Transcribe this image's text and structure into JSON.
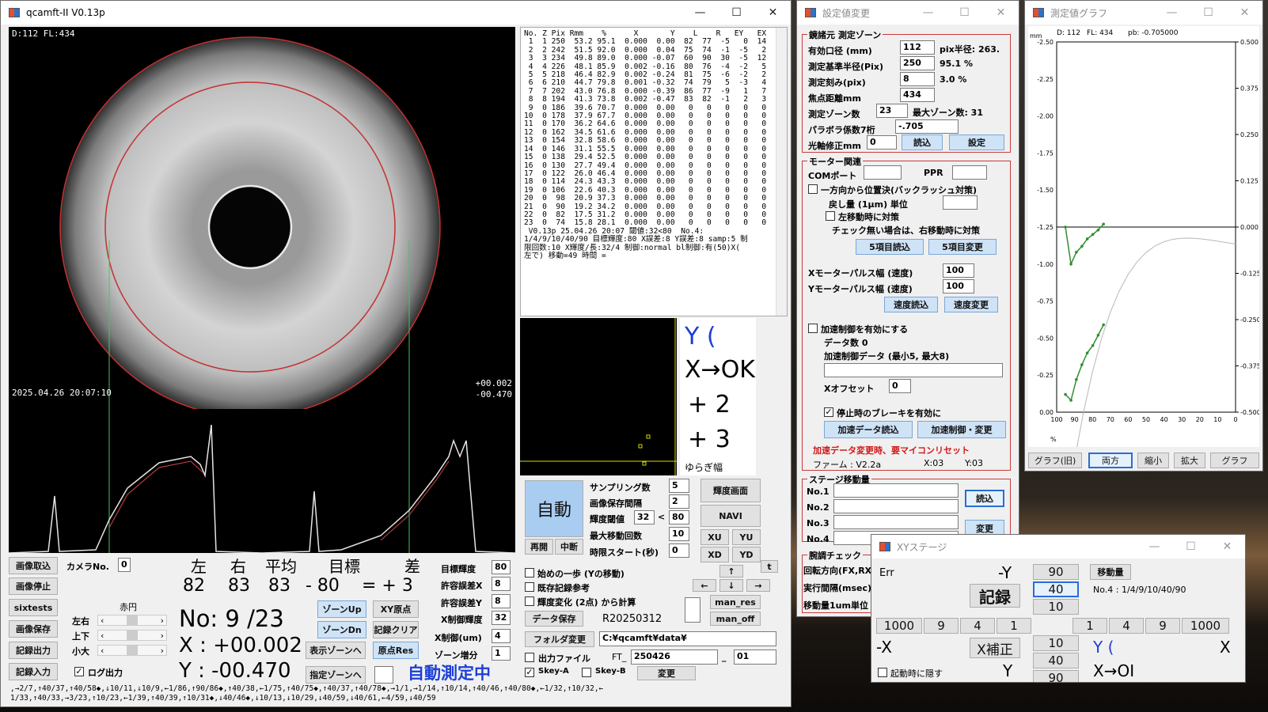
{
  "main": {
    "title": "qcamft-II  V0.13p",
    "overlay_top": "D:112 FL:434",
    "overlay_date": "2025.04.26 20:07:10",
    "overlay_x": "+00.002",
    "overlay_y": "-00.470",
    "table_header": "No. Z Pix Rmm    %      X       Y    L    R   EY   EX   N",
    "table_rows": [
      " 1  1 250  53.2 95.1  0.000  0.00  82  77  -5   0  14",
      " 2  2 242  51.5 92.0  0.000  0.04  75  74  -1  -5   2",
      " 3  3 234  49.8 89.0  0.000 -0.07  60  90  30  -5  12",
      " 4  4 226  48.1 85.9  0.002 -0.16  80  76  -4  -2   5",
      " 5  5 218  46.4 82.9  0.002 -0.24  81  75  -6  -2   2",
      " 6  6 210  44.7 79.8  0.001 -0.32  74  79   5  -3   4",
      " 7  7 202  43.0 76.8  0.000 -0.39  86  77  -9   1   7",
      " 8  8 194  41.3 73.8  0.002 -0.47  83  82  -1   2   3",
      " 9  0 186  39.6 70.7  0.000  0.00   0   0   0   0   0",
      "10  0 178  37.9 67.7  0.000  0.00   0   0   0   0   0",
      "11  0 170  36.2 64.6  0.000  0.00   0   0   0   0   0",
      "12  0 162  34.5 61.6  0.000  0.00   0   0   0   0   0",
      "13  0 154  32.8 58.6  0.000  0.00   0   0   0   0   0",
      "14  0 146  31.1 55.5  0.000  0.00   0   0   0   0   0",
      "15  0 138  29.4 52.5  0.000  0.00   0   0   0   0   0",
      "16  0 130  27.7 49.4  0.000  0.00   0   0   0   0   0",
      "17  0 122  26.0 46.4  0.000  0.00   0   0   0   0   0",
      "18  0 114  24.3 43.3  0.000  0.00   0   0   0   0   0",
      "19  0 106  22.6 40.3  0.000  0.00   0   0   0   0   0",
      "20  0  98  20.9 37.3  0.000  0.00   0   0   0   0   0",
      "21  0  90  19.2 34.2  0.000  0.00   0   0   0   0   0",
      "22  0  82  17.5 31.2  0.000  0.00   0   0   0   0   0",
      "23  0  74  15.8 28.1  0.000  0.00   0   0   0   0   0"
    ],
    "table_note1": " V0.13p 25.04.26 20:07 閾値:32<80  No.4:",
    "table_note2": "1/4/9/10/40/90 目標輝度:80 X誤差:8 Y誤差:8 samp:5 制",
    "table_note3": "限回数:10 X輝度/長:32/4 制御:normal bl制御:有(50)X(",
    "table_note4": "左で) 移動=49 時間 =",
    "yx_y": "Y (",
    "yx_x": "X→OK",
    "yx_p1": "+    2",
    "yx_p2": "+    3",
    "yuragi": "ゆらぎ幅",
    "btn_capture": "画像取込",
    "btn_stop": "画像停止",
    "btn_sixtests": "sixtests",
    "btn_save_img": "画像保存",
    "btn_rec_out": "記録出力",
    "btn_rec_in": "記録入力",
    "camera_no_label": "カメラNo.",
    "camera_no": "0",
    "akaen": "赤円",
    "lr": "左右",
    "ud": "上下",
    "sm": "小大",
    "log_out": "ログ出力",
    "hdr_left": "左",
    "hdr_right": "右",
    "hdr_avg": "平均",
    "hdr_target": "目標",
    "hdr_diff": "差",
    "val_left": "82",
    "val_right": "83",
    "val_avg": "83",
    "val_target": "- 80",
    "val_diff": "= + 3",
    "no_label": "No: 9 /23",
    "x_label": "X : +00.002",
    "y_label": "Y : -00.470",
    "btn_zoneup": "ゾーンUp",
    "btn_zonedn": "ゾーンDn",
    "btn_dispzone": "表示ゾーンへ",
    "btn_speczone": "指定ゾーンへ",
    "btn_xyorigin": "XY原点",
    "btn_recclear": "記録クリア",
    "btn_originres": "原点Res",
    "auto_status": "自動測定中",
    "target_bright_label": "目標輝度",
    "target_bright": "80",
    "tol_x_label": "許容誤差X",
    "tol_x": "8",
    "tol_y_label": "許容誤差Y",
    "tol_y": "8",
    "x_ctrl_bright_label": "X制御輝度",
    "x_ctrl_bright": "32",
    "x_ctrl_um_label": "X制御(um)",
    "x_ctrl_um": "4",
    "zone_inc_label": "ゾーン増分",
    "zone_inc": "1",
    "btn_auto": "自動",
    "btn_resume": "再開",
    "btn_pause": "中断",
    "sampling_label": "サンプリング数",
    "sampling": "5",
    "save_interval_label": "画像保存間隔",
    "save_interval": "2",
    "thresh_label": "輝度閾値",
    "thresh": "32",
    "thresh_cmp": "<",
    "thresh2": "80",
    "max_move_label": "最大移動回数",
    "max_move": "10",
    "delay_label": "時限スタート(秒)",
    "delay": "0",
    "btn_bright": "輝度画面",
    "btn_navi": "NAVI",
    "btn_xu": "XU",
    "btn_yu": "YU",
    "btn_xd": "XD",
    "btn_yd": "YD",
    "chk_first_step": "始めの一歩 (Yの移動)",
    "chk_existing": "既存記録参考",
    "chk_bright_change": "輝度変化 (2点) から計算",
    "btn_data_save": "データ保存",
    "record_name": "R20250312",
    "btn_up": "↑",
    "btn_left": "←",
    "btn_down": "↓",
    "btn_right": "→",
    "btn_t": "t",
    "btn_man_res": "man_res",
    "btn_man_off": "man_off",
    "btn_folder": "フォルダ変更",
    "folder_path": "C:¥qcamft¥data¥",
    "chk_outfile": "出力ファイル",
    "ft_label": "FT_",
    "ft_value": "250426",
    "ft_sep": "_",
    "ft_suffix": "01",
    "skey_a": "Skey-A",
    "skey_b": "Skey-B",
    "btn_change": "変更",
    "log_line1": ",→2/7,↑40/37,↑40/58◆,↓10/11,↓10/9,←1/86,↑90/86◆,↑40/38,←1/75,↑40/75◆,↑40/37,↑40/78◆,→1/1,→1/14,↑10/14,↑40/46,↑40/80◆,←1/32,↑10/32,←",
    "log_line2": "1/33,↑40/33,→3/23,↑10/23,←1/39,↑40/39,↑10/31◆,↓40/46◆,↓10/13,↓10/29,↓40/59,↓40/61,←4/59,↓40/59"
  },
  "settings": {
    "title": "設定値変更",
    "grp_mirror": "鏡諸元 測定ゾーン",
    "aperture_label": "有効口径 (mm)",
    "aperture": "112",
    "pix_radius_label": "pix半径: 263.",
    "ref_radius_label": "測定基準半径(Pix)",
    "ref_radius": "250",
    "ref_pct": "95.1 %",
    "step_label": "測定刻み(pix)",
    "step": "8",
    "step_pct": "3.0 %",
    "focal_label": "焦点距離mm",
    "focal": "434",
    "zones_label": "測定ゾーン数",
    "zones": "23",
    "max_zones_label": "最大ゾーン数:  31",
    "parabola_label": "パラボラ係数7桁",
    "parabola": "-.705",
    "optaxis_label": "光軸修正mm",
    "optaxis": "0",
    "btn_read": "読込",
    "btn_set": "設定",
    "grp_motor": "モーター関連",
    "com_label": "COMポート",
    "com": "",
    "ppr_label": "PPR",
    "ppr": "",
    "chk_oneway": "一方向から位置決(バックラッシュ対策)",
    "return_label": "戻し量 (1μm) 単位",
    "return_val": "",
    "chk_left": "左移動時に対策",
    "note_right": "チェック無い場合は、右移動時に対策",
    "btn_5read": "5項目読込",
    "btn_5change": "5項目変更",
    "xpulse_label": "Xモーターパルス幅 (速度)",
    "xpulse": "100",
    "ypulse_label": "Yモーターパルス幅 (速度)",
    "ypulse": "100",
    "btn_speed_read": "速度読込",
    "btn_speed_change": "速度変更",
    "chk_accel": "加速制御を有効にする",
    "data_count": "データ数  0",
    "accel_data_label": "加速制御データ (最小5, 最大8)",
    "accel_data": "",
    "xoffset_label": "Xオフセット",
    "xoffset": "0",
    "chk_brake": "停止時のブレーキを有効に",
    "btn_accel_read": "加速データ読込",
    "btn_accel_change": "加速制御・変更",
    "warn": "加速データ変更時、要マイコンリセット",
    "firmware": "ファーム : V2.2a",
    "fx": "X:03",
    "fy": "Y:03",
    "grp_stage": "ステージ移動量",
    "s1": "No.1",
    "s2": "No.2",
    "s3": "No.3",
    "s4": "No.4",
    "btn_stage_read": "読込",
    "btn_stage_change": "変更",
    "grp_adjust": "腕調チェック",
    "rot_label": "回転方向(FX,RX",
    "interval_label": "実行間隔(msec)",
    "move_unit_label": "移動量1um単位"
  },
  "graph": {
    "title": "測定値グラフ",
    "info_d": "D: 112",
    "info_fl": "FL: 434",
    "info_pb": "pb: -0.705000",
    "unit_mm": "mm",
    "unit_pct": "%",
    "left_ticks": [
      "-2.50",
      "-2.25",
      "-2.00",
      "-1.75",
      "-1.50",
      "-1.25",
      "-1.00",
      "-0.75",
      "-0.50",
      "-0.25",
      "0.00"
    ],
    "right_ticks": [
      "0.500",
      "0.375",
      "0.250",
      "0.125",
      "0.000",
      "-0.125",
      "-0.250",
      "-0.375",
      "-0.500"
    ],
    "bottom_ticks": [
      "100",
      "90",
      "80",
      "70",
      "60",
      "50",
      "40",
      "30",
      "20",
      "10",
      "0"
    ],
    "btn_old": "グラフ(旧)",
    "btn_both": "両方",
    "btn_shrink": "縮小",
    "btn_expand": "拡大",
    "btn_graph": "グラフ"
  },
  "chart_data": {
    "type": "line",
    "xlim": [
      100,
      0
    ],
    "ylim": [
      -2.5,
      0
    ],
    "y2lim": [
      -0.5,
      0.5
    ],
    "series": [
      {
        "x": [
          95.1,
          92.0,
          89.0,
          85.9,
          82.9,
          79.8,
          76.8,
          73.8
        ],
        "y": [
          -1.25,
          -1.0,
          -1.08,
          -1.12,
          -1.17,
          -1.2,
          -1.23,
          -1.27
        ]
      },
      {
        "x": [
          95.1,
          92.0,
          89.0,
          85.9,
          82.9,
          79.8,
          76.8,
          73.8
        ],
        "y": [
          -0.12,
          -0.08,
          -0.22,
          -0.32,
          -0.4,
          -0.45,
          -0.52,
          -0.59
        ]
      }
    ]
  },
  "xy": {
    "title": "XYステージ",
    "err": "Err",
    "minus_y": "-Y",
    "v90": "90",
    "btn_amount": "移動量",
    "v40": "40",
    "no4": "No.4 :  1/4/9/10/40/90",
    "btn_record": "記録",
    "v10": "10",
    "n1000": "1000",
    "n9": "9",
    "n4": "4",
    "n1": "1",
    "p1": "1",
    "p4": "4",
    "p9": "9",
    "p1000": "1000",
    "minus_x": "-X",
    "btn_xcorr": "X補正",
    "v10b": "10",
    "v40b": "40",
    "yy": "Y (",
    "xlabel": "X",
    "chk_hide": "起動時に隠す",
    "ylabel": "Y",
    "v90b": "90",
    "xok": "X→OI"
  }
}
